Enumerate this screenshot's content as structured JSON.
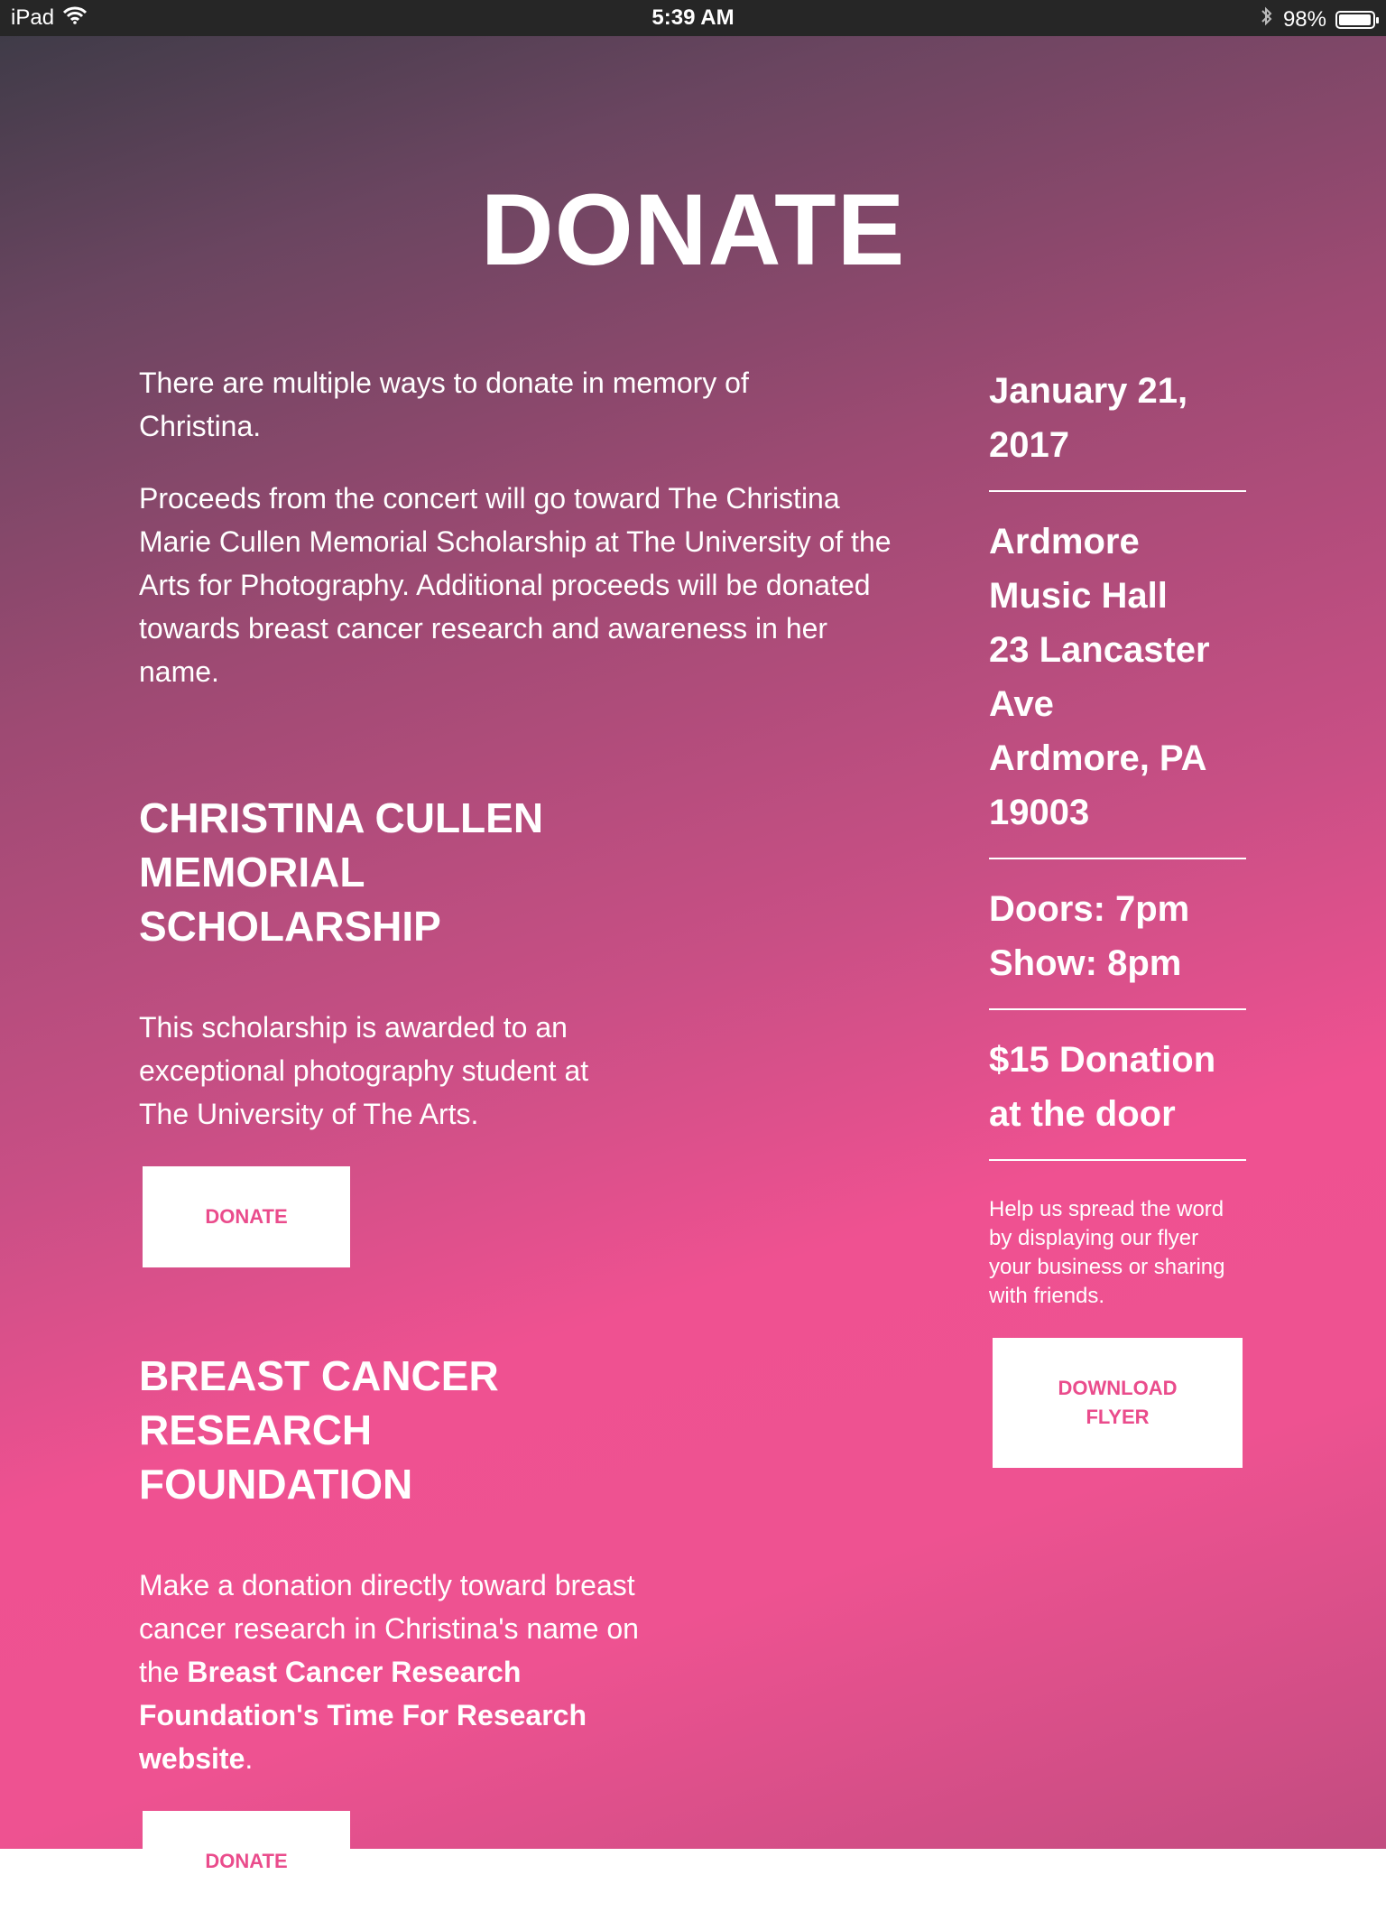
{
  "status_bar": {
    "device": "iPad",
    "time": "5:39 AM",
    "battery": "98%",
    "battery_level": 0.98
  },
  "page_title": "DONATE",
  "intro": {
    "p1": "There are multiple ways to donate in memory of Christina.",
    "p2": "Proceeds from the concert will go toward The Christina Marie Cullen Memorial Scholarship at The University of the Arts for Photography. Additional proceeds will be donated towards breast cancer research and awareness in her name."
  },
  "scholarship": {
    "heading_line1": "CHRISTINA CULLEN",
    "heading_line2": "MEMORIAL",
    "heading_line3": "SCHOLARSHIP",
    "text": "This scholarship is awarded to an exceptional photography student at The University of The Arts.",
    "button": "DONATE"
  },
  "foundation": {
    "heading_line1": "BREAST CANCER",
    "heading_line2": "RESEARCH",
    "heading_line3": "FOUNDATION",
    "text_before": "Make a donation directly toward breast cancer research in Christina's name on the ",
    "link": "Breast Cancer Research Foundation's Time For Research website",
    "text_after": ".",
    "button": "DONATE"
  },
  "sidebar": {
    "date_line1": "January 21,",
    "date_line2": "2017",
    "venue_line1": "Ardmore",
    "venue_line2": "Music Hall",
    "venue_line3": "23 Lancaster",
    "venue_line4": "Ave",
    "venue_line5": "Ardmore, PA",
    "venue_line6": "19003",
    "doors": "Doors: 7pm",
    "show": "Show: 8pm",
    "price_line1": "$15 Donation",
    "price_line2": "at the door",
    "share_text": "Help us spread the word by displaying our flyer your business or sharing with friends.",
    "download_line1": "DOWNLOAD",
    "download_line2": "FLYER"
  },
  "colors": {
    "accent": "#ea4c8c",
    "status_bar_bg": "#262626",
    "gradient_top": "#3a3a45",
    "gradient_mid": "#ef5191"
  },
  "icons": {
    "wifi": "wifi-icon",
    "bluetooth": "bluetooth-icon",
    "battery": "battery-icon"
  }
}
